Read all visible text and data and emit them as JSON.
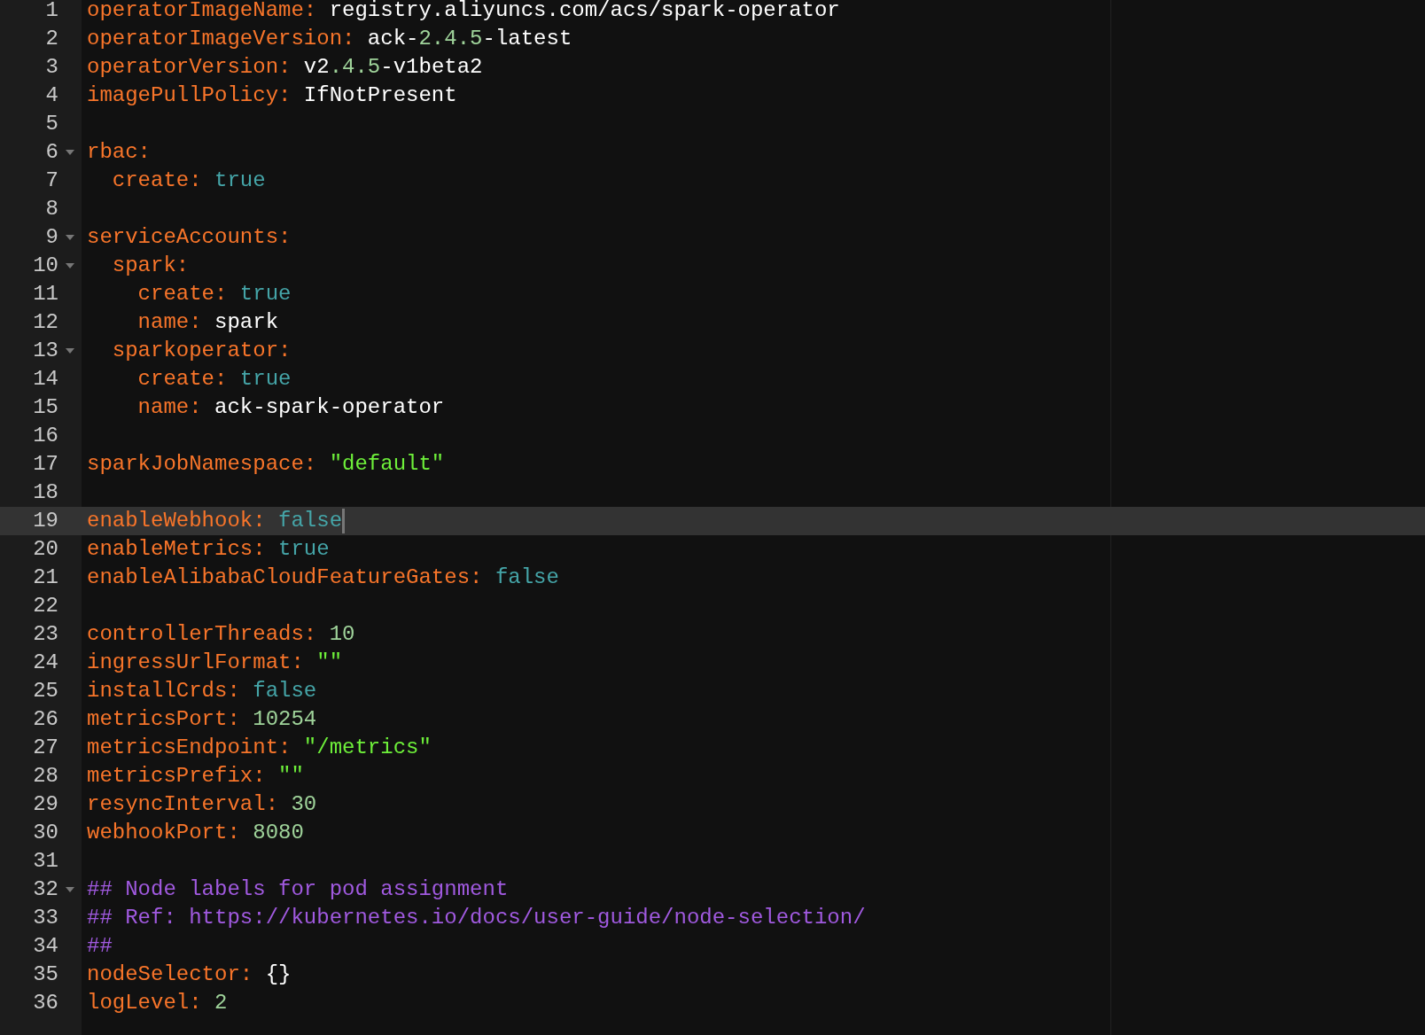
{
  "editor": {
    "lines": [
      {
        "number": "1",
        "foldable": false,
        "current": false,
        "tokens": [
          {
            "kind": "key",
            "text": "operatorImageName:"
          },
          {
            "kind": "plain",
            "text": " registry.aliyuncs.com/acs/spark-operator"
          }
        ]
      },
      {
        "number": "2",
        "foldable": false,
        "current": false,
        "tokens": [
          {
            "kind": "key",
            "text": "operatorImageVersion:"
          },
          {
            "kind": "plain",
            "text": " ack-"
          },
          {
            "kind": "number",
            "text": "2.4.5"
          },
          {
            "kind": "plain",
            "text": "-latest"
          }
        ]
      },
      {
        "number": "3",
        "foldable": false,
        "current": false,
        "tokens": [
          {
            "kind": "key",
            "text": "operatorVersion:"
          },
          {
            "kind": "plain",
            "text": " v2"
          },
          {
            "kind": "number",
            "text": ".4.5"
          },
          {
            "kind": "plain",
            "text": "-v1beta2"
          }
        ]
      },
      {
        "number": "4",
        "foldable": false,
        "current": false,
        "tokens": [
          {
            "kind": "key",
            "text": "imagePullPolicy:"
          },
          {
            "kind": "plain",
            "text": " IfNotPresent"
          }
        ]
      },
      {
        "number": "5",
        "foldable": false,
        "current": false
      },
      {
        "number": "6",
        "foldable": true,
        "current": false,
        "tokens": [
          {
            "kind": "key",
            "text": "rbac:"
          }
        ]
      },
      {
        "number": "7",
        "foldable": false,
        "current": false,
        "tokens": [
          {
            "kind": "key",
            "text": "  create:"
          },
          {
            "kind": "bool",
            "text": " true"
          }
        ]
      },
      {
        "number": "8",
        "foldable": false,
        "current": false
      },
      {
        "number": "9",
        "foldable": true,
        "current": false,
        "tokens": [
          {
            "kind": "key",
            "text": "serviceAccounts:"
          }
        ]
      },
      {
        "number": "10",
        "foldable": true,
        "current": false,
        "tokens": [
          {
            "kind": "key",
            "text": "  spark:"
          }
        ]
      },
      {
        "number": "11",
        "foldable": false,
        "current": false,
        "tokens": [
          {
            "kind": "key",
            "text": "    create:"
          },
          {
            "kind": "bool",
            "text": " true"
          }
        ]
      },
      {
        "number": "12",
        "foldable": false,
        "current": false,
        "tokens": [
          {
            "kind": "key",
            "text": "    name:"
          },
          {
            "kind": "plain",
            "text": " spark"
          }
        ]
      },
      {
        "number": "13",
        "foldable": true,
        "current": false,
        "tokens": [
          {
            "kind": "key",
            "text": "  sparkoperator:"
          }
        ]
      },
      {
        "number": "14",
        "foldable": false,
        "current": false,
        "tokens": [
          {
            "kind": "key",
            "text": "    create:"
          },
          {
            "kind": "bool",
            "text": " true"
          }
        ]
      },
      {
        "number": "15",
        "foldable": false,
        "current": false,
        "tokens": [
          {
            "kind": "key",
            "text": "    name:"
          },
          {
            "kind": "plain",
            "text": " ack-spark-operator"
          }
        ]
      },
      {
        "number": "16",
        "foldable": false,
        "current": false
      },
      {
        "number": "17",
        "foldable": false,
        "current": false,
        "tokens": [
          {
            "kind": "key",
            "text": "sparkJobNamespace:"
          },
          {
            "kind": "string",
            "text": " \"default\""
          }
        ]
      },
      {
        "number": "18",
        "foldable": false,
        "current": false
      },
      {
        "number": "19",
        "foldable": false,
        "current": true,
        "tokens": [
          {
            "kind": "key",
            "text": "enableWebhook:"
          },
          {
            "kind": "bool",
            "text": " false"
          }
        ]
      },
      {
        "number": "20",
        "foldable": false,
        "current": false,
        "tokens": [
          {
            "kind": "key",
            "text": "enableMetrics:"
          },
          {
            "kind": "bool",
            "text": " true"
          }
        ]
      },
      {
        "number": "21",
        "foldable": false,
        "current": false,
        "tokens": [
          {
            "kind": "key",
            "text": "enableAlibabaCloudFeatureGates:"
          },
          {
            "kind": "bool",
            "text": " false"
          }
        ]
      },
      {
        "number": "22",
        "foldable": false,
        "current": false
      },
      {
        "number": "23",
        "foldable": false,
        "current": false,
        "tokens": [
          {
            "kind": "key",
            "text": "controllerThreads:"
          },
          {
            "kind": "number",
            "text": " 10"
          }
        ]
      },
      {
        "number": "24",
        "foldable": false,
        "current": false,
        "tokens": [
          {
            "kind": "key",
            "text": "ingressUrlFormat:"
          },
          {
            "kind": "string",
            "text": " \"\""
          }
        ]
      },
      {
        "number": "25",
        "foldable": false,
        "current": false,
        "tokens": [
          {
            "kind": "key",
            "text": "installCrds:"
          },
          {
            "kind": "bool",
            "text": " false"
          }
        ]
      },
      {
        "number": "26",
        "foldable": false,
        "current": false,
        "tokens": [
          {
            "kind": "key",
            "text": "metricsPort:"
          },
          {
            "kind": "number",
            "text": " 10254"
          }
        ]
      },
      {
        "number": "27",
        "foldable": false,
        "current": false,
        "tokens": [
          {
            "kind": "key",
            "text": "metricsEndpoint:"
          },
          {
            "kind": "string",
            "text": " \"/metrics\""
          }
        ]
      },
      {
        "number": "28",
        "foldable": false,
        "current": false,
        "tokens": [
          {
            "kind": "key",
            "text": "metricsPrefix:"
          },
          {
            "kind": "string",
            "text": " \"\""
          }
        ]
      },
      {
        "number": "29",
        "foldable": false,
        "current": false,
        "tokens": [
          {
            "kind": "key",
            "text": "resyncInterval:"
          },
          {
            "kind": "number",
            "text": " 30"
          }
        ]
      },
      {
        "number": "30",
        "foldable": false,
        "current": false,
        "tokens": [
          {
            "kind": "key",
            "text": "webhookPort:"
          },
          {
            "kind": "number",
            "text": " 8080"
          }
        ]
      },
      {
        "number": "31",
        "foldable": false,
        "current": false
      },
      {
        "number": "32",
        "foldable": true,
        "current": false,
        "tokens": [
          {
            "kind": "comment",
            "text": "## Node labels for pod assignment"
          }
        ]
      },
      {
        "number": "33",
        "foldable": false,
        "current": false,
        "tokens": [
          {
            "kind": "comment",
            "text": "## Ref: https://kubernetes.io/docs/user-guide/node-selection/"
          }
        ]
      },
      {
        "number": "34",
        "foldable": false,
        "current": false,
        "tokens": [
          {
            "kind": "comment",
            "text": "##"
          }
        ]
      },
      {
        "number": "35",
        "foldable": false,
        "current": false,
        "tokens": [
          {
            "kind": "key",
            "text": "nodeSelector:"
          },
          {
            "kind": "plain",
            "text": " {}"
          }
        ]
      },
      {
        "number": "36",
        "foldable": false,
        "current": false,
        "tokens": [
          {
            "kind": "key",
            "text": "logLevel:"
          },
          {
            "kind": "number",
            "text": " 2"
          }
        ]
      }
    ]
  }
}
